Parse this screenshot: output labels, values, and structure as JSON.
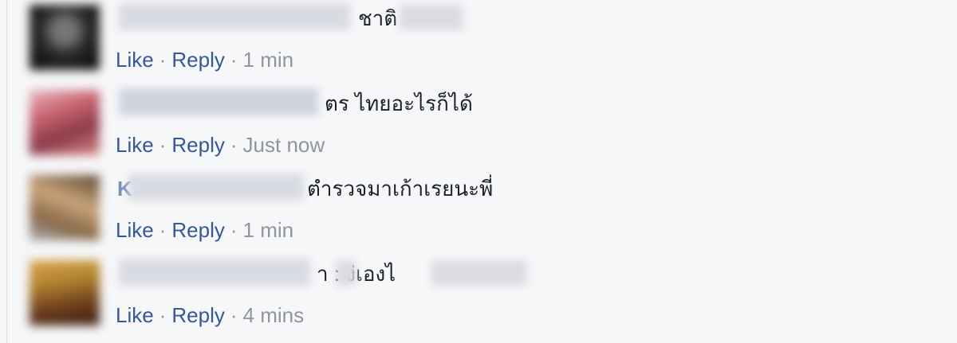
{
  "comments": [
    {
      "text": "ชาติ",
      "like": "Like",
      "reply": "Reply",
      "sep": "·",
      "time": "1 min",
      "avatar_colors": [
        "#3a3a3a",
        "#1c1c1c",
        "#6a6a6a"
      ]
    },
    {
      "text": "ตร ไทยอะไรก็ได้",
      "like": "Like",
      "reply": "Reply",
      "sep": "·",
      "time": "Just now",
      "avatar_colors": [
        "#c7646f",
        "#8c3a4a",
        "#e8b7c2"
      ]
    },
    {
      "name_fragment": "K",
      "text": "ตำรวจมาเก้าเรยนะพี่",
      "like": "Like",
      "reply": "Reply",
      "sep": "·",
      "time": "1 min",
      "avatar_colors": [
        "#8a6a4a",
        "#c9a57c",
        "#5a4330"
      ]
    },
    {
      "text": "า :  ง่เองไ",
      "like": "Like",
      "reply": "Reply",
      "sep": "·",
      "time": "4 mins",
      "avatar_colors": [
        "#b0822e",
        "#6b3b1d",
        "#d9a64d"
      ]
    }
  ],
  "colors": {
    "background": "#f6f7f9",
    "link": "#365899",
    "meta": "#90949c",
    "text": "#1d2129"
  }
}
